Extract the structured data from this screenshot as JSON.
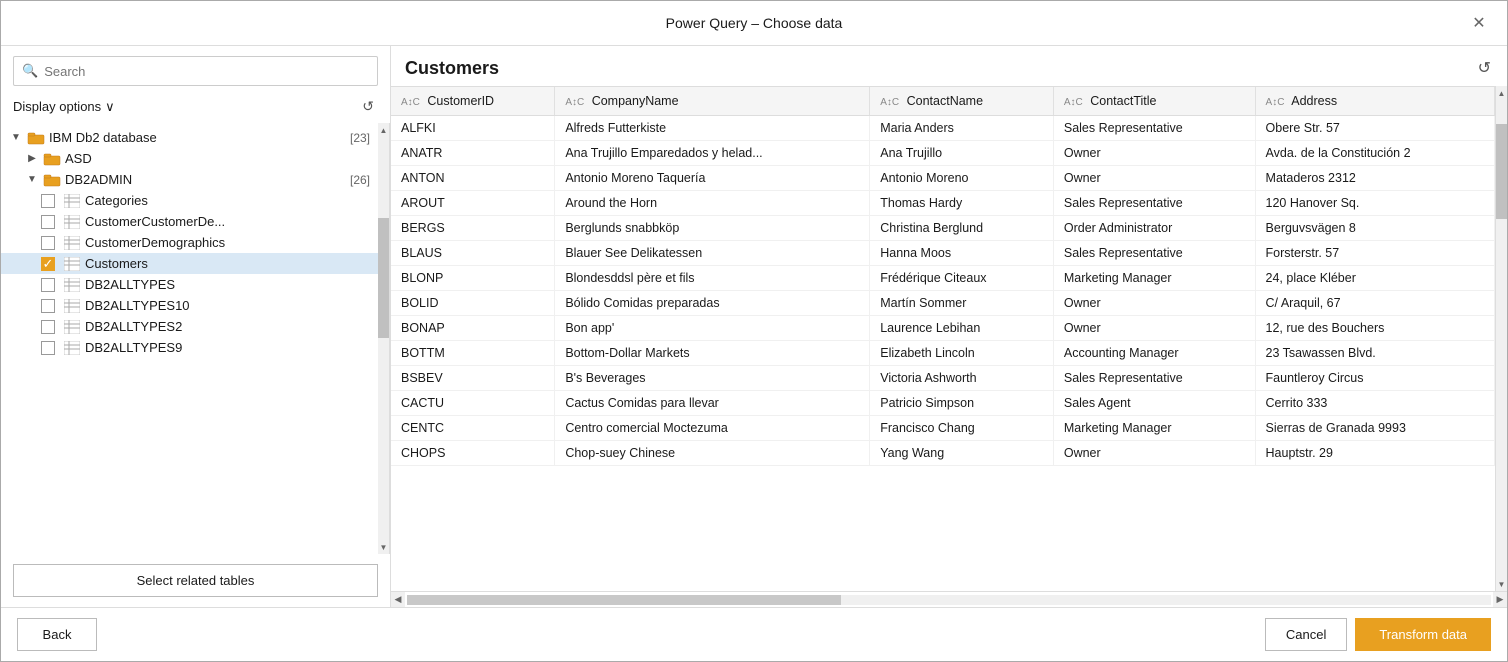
{
  "dialog": {
    "title": "Power Query – Choose data",
    "close_label": "✕"
  },
  "left_panel": {
    "search_placeholder": "Search",
    "display_options_label": "Display options",
    "chevron": "∨",
    "refresh_icon": "↺",
    "tree": [
      {
        "id": "ibm-db2",
        "label": "IBM Db2 database",
        "count": "[23]",
        "level": 1,
        "type": "folder",
        "expanded": true,
        "arrow": "▼"
      },
      {
        "id": "asd",
        "label": "ASD",
        "count": "",
        "level": 2,
        "type": "folder",
        "expanded": false,
        "arrow": "▶"
      },
      {
        "id": "db2admin",
        "label": "DB2ADMIN",
        "count": "[26]",
        "level": 2,
        "type": "folder",
        "expanded": true,
        "arrow": "▼"
      },
      {
        "id": "categories",
        "label": "Categories",
        "count": "",
        "level": 3,
        "type": "table",
        "checked": false
      },
      {
        "id": "customer-customer-de",
        "label": "CustomerCustomerDe...",
        "count": "",
        "level": 3,
        "type": "table",
        "checked": false
      },
      {
        "id": "customer-demographics",
        "label": "CustomerDemographics",
        "count": "",
        "level": 3,
        "type": "table",
        "checked": false
      },
      {
        "id": "customers",
        "label": "Customers",
        "count": "",
        "level": 3,
        "type": "table",
        "checked": true,
        "selected": true
      },
      {
        "id": "db2alltypes",
        "label": "DB2ALLTYPES",
        "count": "",
        "level": 3,
        "type": "table",
        "checked": false
      },
      {
        "id": "db2alltypes10",
        "label": "DB2ALLTYPES10",
        "count": "",
        "level": 3,
        "type": "table",
        "checked": false
      },
      {
        "id": "db2alltypes2",
        "label": "DB2ALLTYPES2",
        "count": "",
        "level": 3,
        "type": "table",
        "checked": false
      },
      {
        "id": "db2alltypes9",
        "label": "DB2ALLTYPES9",
        "count": "",
        "level": 3,
        "type": "table",
        "checked": false
      }
    ],
    "select_related_btn": "Select related tables"
  },
  "right_panel": {
    "title": "Customers",
    "refresh_icon": "↺",
    "columns": [
      {
        "name": "CustomerID",
        "type": "ABC"
      },
      {
        "name": "CompanyName",
        "type": "ABC"
      },
      {
        "name": "ContactName",
        "type": "ABC"
      },
      {
        "name": "ContactTitle",
        "type": "ABC"
      },
      {
        "name": "Address",
        "type": "ABC"
      }
    ],
    "rows": [
      [
        "ALFKI",
        "Alfreds Futterkiste",
        "Maria Anders",
        "Sales Representative",
        "Obere Str. 57"
      ],
      [
        "ANATR",
        "Ana Trujillo Emparedados y helad...",
        "Ana Trujillo",
        "Owner",
        "Avda. de la Constitución 2"
      ],
      [
        "ANTON",
        "Antonio Moreno Taquería",
        "Antonio Moreno",
        "Owner",
        "Mataderos 2312"
      ],
      [
        "AROUT",
        "Around the Horn",
        "Thomas Hardy",
        "Sales Representative",
        "120 Hanover Sq."
      ],
      [
        "BERGS",
        "Berglunds snabbköp",
        "Christina Berglund",
        "Order Administrator",
        "Berguvsvägen 8"
      ],
      [
        "BLAUS",
        "Blauer See Delikatessen",
        "Hanna Moos",
        "Sales Representative",
        "Forsterstr. 57"
      ],
      [
        "BLONP",
        "Blondesddsl père et fils",
        "Frédérique Citeaux",
        "Marketing Manager",
        "24, place Kléber"
      ],
      [
        "BOLID",
        "Bólido Comidas preparadas",
        "Martín Sommer",
        "Owner",
        "C/ Araquil, 67"
      ],
      [
        "BONAP",
        "Bon app'",
        "Laurence Lebihan",
        "Owner",
        "12, rue des Bouchers"
      ],
      [
        "BOTTM",
        "Bottom-Dollar Markets",
        "Elizabeth Lincoln",
        "Accounting Manager",
        "23 Tsawassen Blvd."
      ],
      [
        "BSBEV",
        "B's Beverages",
        "Victoria Ashworth",
        "Sales Representative",
        "Fauntleroy Circus"
      ],
      [
        "CACTU",
        "Cactus Comidas para llevar",
        "Patricio Simpson",
        "Sales Agent",
        "Cerrito 333"
      ],
      [
        "CENTC",
        "Centro comercial Moctezuma",
        "Francisco Chang",
        "Marketing Manager",
        "Sierras de Granada 9993"
      ],
      [
        "CHOPS",
        "Chop-suey Chinese",
        "Yang Wang",
        "Owner",
        "Hauptstr. 29"
      ]
    ]
  },
  "bottom_bar": {
    "back_label": "Back",
    "cancel_label": "Cancel",
    "transform_label": "Transform data"
  }
}
